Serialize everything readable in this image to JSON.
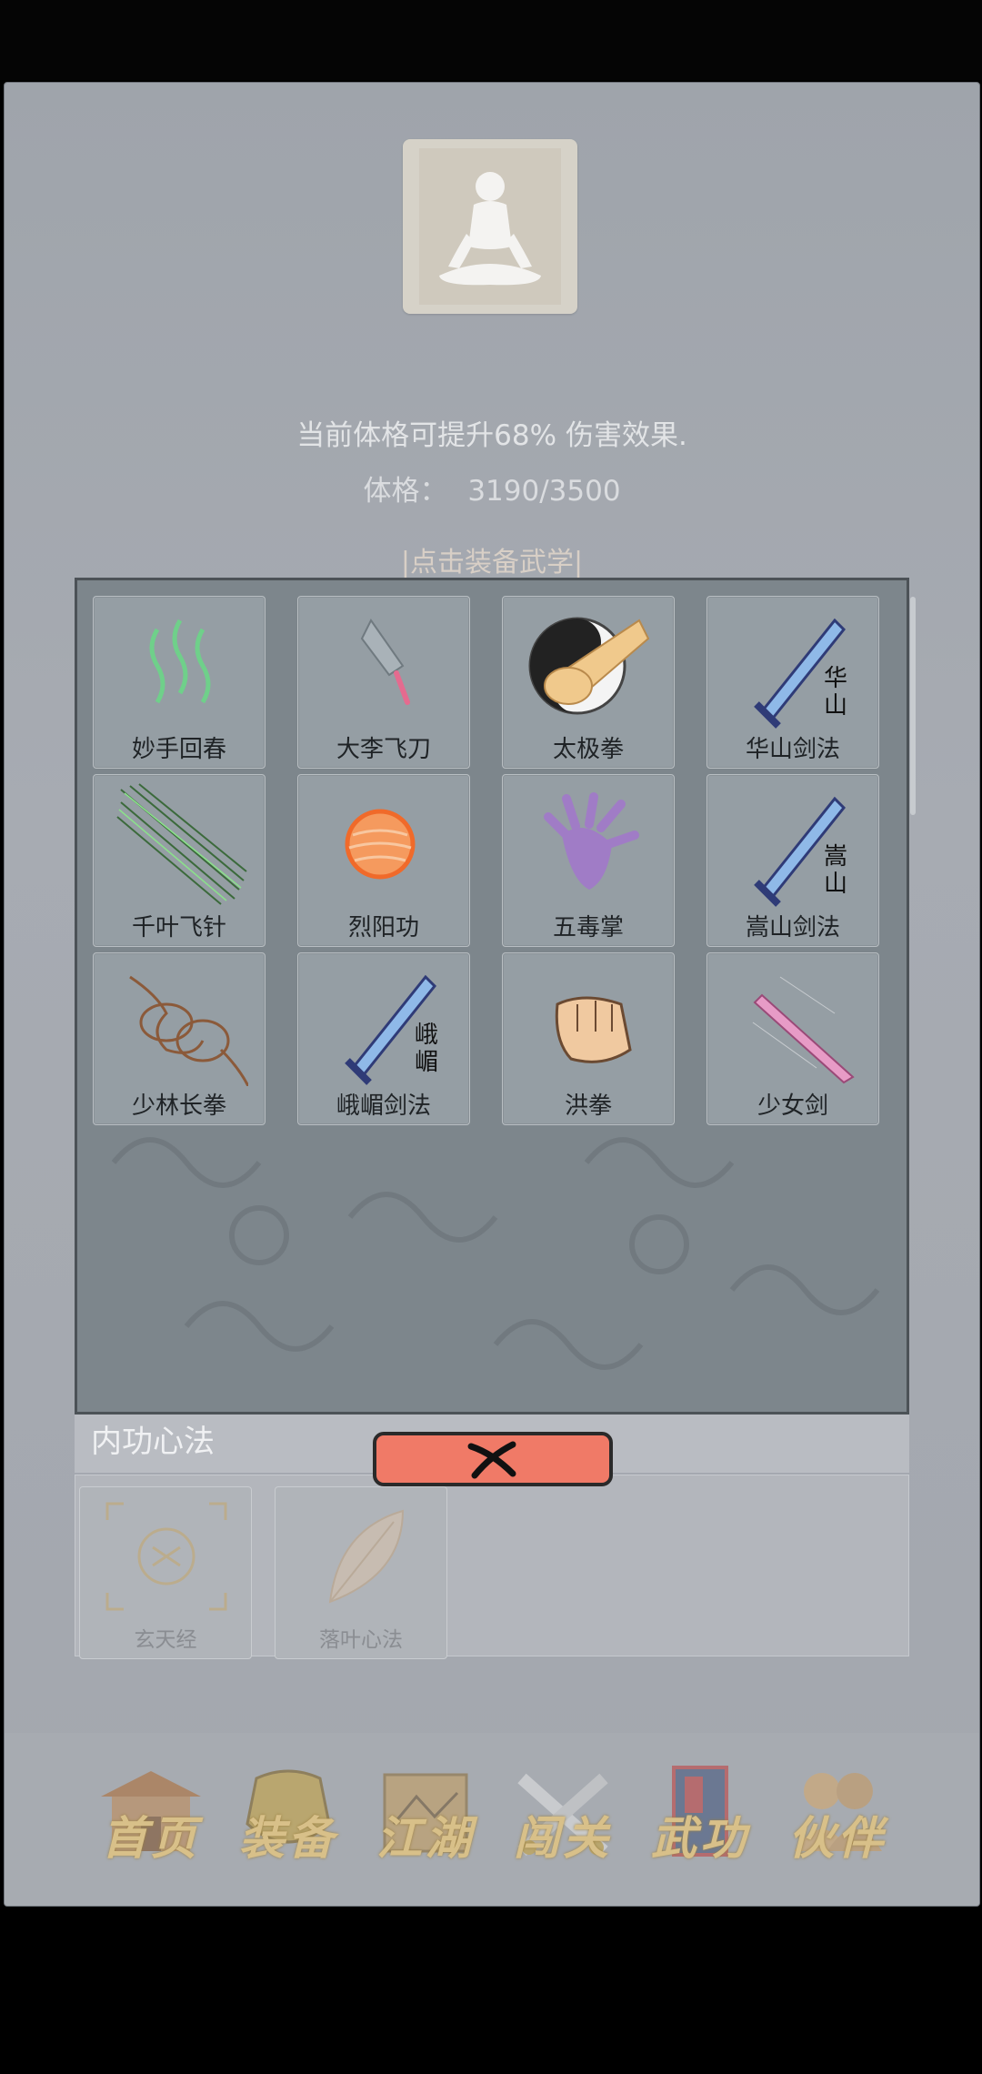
{
  "status": {
    "bonus_text": "当前体格可提升68% 伤害效果.",
    "constitution_label": "体格：",
    "constitution_value": "3190/3500"
  },
  "equip_link": "|点击装备武学|",
  "skills": [
    {
      "label": "妙手回春",
      "icon": "green-wisps-icon"
    },
    {
      "label": "大李飞刀",
      "icon": "flying-knife-icon"
    },
    {
      "label": "太极拳",
      "icon": "taiji-fist-icon"
    },
    {
      "label": "华山剑法",
      "icon": "huashan-sword-icon",
      "glyph": "华山"
    },
    {
      "label": "千叶飞针",
      "icon": "flying-needles-icon"
    },
    {
      "label": "烈阳功",
      "icon": "sun-orb-icon"
    },
    {
      "label": "五毒掌",
      "icon": "poison-palm-icon"
    },
    {
      "label": "嵩山剑法",
      "icon": "songshan-sword-icon",
      "glyph": "嵩山"
    },
    {
      "label": "少林长拳",
      "icon": "shaolin-fists-icon"
    },
    {
      "label": "峨嵋剑法",
      "icon": "emei-sword-icon",
      "glyph": "峨嵋"
    },
    {
      "label": "洪拳",
      "icon": "fist-icon"
    },
    {
      "label": "少女剑",
      "icon": "pink-sword-icon"
    }
  ],
  "neigong": {
    "header": "内功心法",
    "items": [
      {
        "label": "玄天经",
        "icon": "xuantian-scroll-icon"
      },
      {
        "label": "落叶心法",
        "icon": "leaf-icon"
      }
    ]
  },
  "nav": [
    {
      "label": "首页",
      "icon": "temple-icon"
    },
    {
      "label": "装备",
      "icon": "armor-icon"
    },
    {
      "label": "江湖",
      "icon": "map-scroll-icon"
    },
    {
      "label": "闯关",
      "icon": "crossed-swords-icon"
    },
    {
      "label": "武功",
      "icon": "martial-book-icon"
    },
    {
      "label": "伙伴",
      "icon": "companions-icon"
    }
  ],
  "colors": {
    "close_button": "#f07a67",
    "nav_text": "#d8c089",
    "panel": "#7d868c"
  }
}
